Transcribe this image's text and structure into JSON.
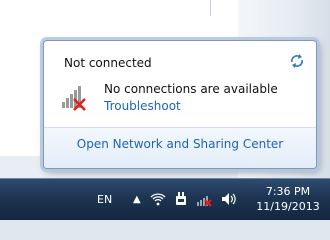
{
  "flyout": {
    "title": "Not connected",
    "status": "No connections are available",
    "troubleshoot": "Troubleshoot",
    "footer_link": "Open Network and Sharing Center"
  },
  "taskbar": {
    "language": "EN",
    "time": "7:36 PM",
    "date": "11/19/2013"
  },
  "icons": [
    "refresh-icon",
    "wireless-no-connection-icon",
    "show-hidden-icons-arrow",
    "wireless-signal-icon",
    "power-plug-icon",
    "network-disconnected-icon",
    "volume-icon"
  ],
  "colors": {
    "link": "#1e64b5",
    "error_x": "#e0201b",
    "taskbar": "#1d3553"
  }
}
